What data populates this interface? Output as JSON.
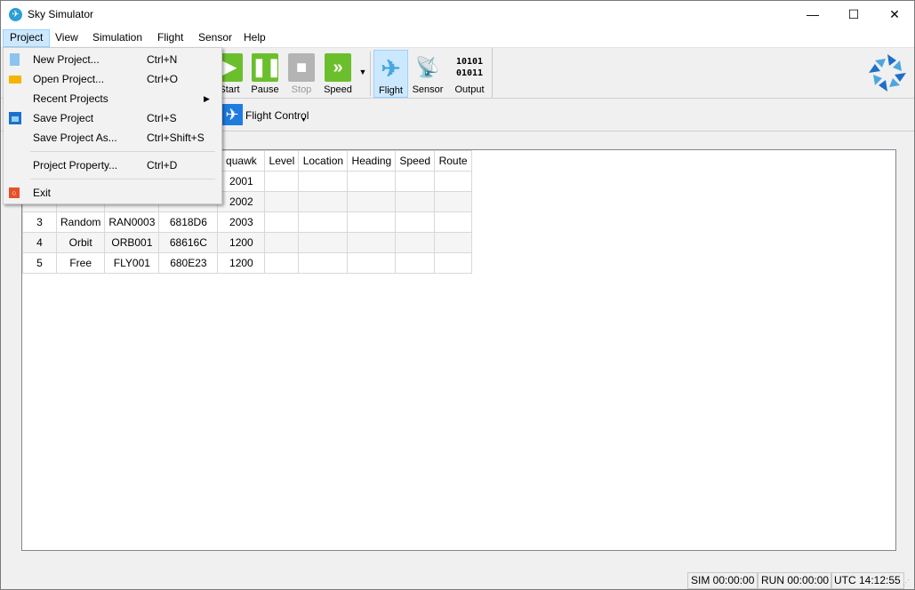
{
  "window": {
    "title": "Sky Simulator",
    "minimize": "—",
    "maximize": "☐",
    "close": "✕"
  },
  "menubar": [
    "Project",
    "View",
    "Simulation",
    "Flight",
    "Sensor",
    "Help"
  ],
  "toolbar": {
    "start": "Start",
    "pause": "Pause",
    "stop": "Stop",
    "speed": "Speed",
    "flight": "Flight",
    "sensor": "Sensor",
    "output": "Output",
    "output_glyph": "10101\n01011"
  },
  "toolbar2": {
    "flight_control": "Flight Control"
  },
  "project_menu": [
    {
      "label": "New Project...",
      "shortcut": "Ctrl+N",
      "icon": "new-file-icon"
    },
    {
      "label": "Open Project...",
      "shortcut": "Ctrl+O",
      "icon": "folder-icon"
    },
    {
      "label": "Recent Projects",
      "shortcut": "",
      "icon": "submenu-arrow-icon"
    },
    {
      "label": "Save Project",
      "shortcut": "Ctrl+S",
      "icon": "save-icon"
    },
    {
      "label": "Save Project As...",
      "shortcut": "Ctrl+Shift+S",
      "icon": ""
    },
    {
      "label": "Project Property...",
      "shortcut": "Ctrl+D",
      "icon": ""
    },
    {
      "label": "Exit",
      "shortcut": "",
      "icon": "power-icon"
    }
  ],
  "table": {
    "headers": [
      "",
      "",
      "",
      "",
      "quawk",
      "Level",
      "Location",
      "Heading",
      "Speed",
      "Route"
    ],
    "rows": [
      [
        "",
        "",
        "",
        "",
        "2001",
        "",
        "",
        "",
        "",
        ""
      ],
      [
        "",
        "",
        "",
        "",
        "2002",
        "",
        "",
        "",
        "",
        ""
      ],
      [
        "3",
        "Random",
        "RAN0003",
        "6818D6",
        "2003",
        "",
        "",
        "",
        "",
        ""
      ],
      [
        "4",
        "Orbit",
        "ORB001",
        "68616C",
        "1200",
        "",
        "",
        "",
        "",
        ""
      ],
      [
        "5",
        "Free",
        "FLY001",
        "680E23",
        "1200",
        "",
        "",
        "",
        "",
        ""
      ]
    ]
  },
  "status": {
    "sim": "SIM 00:00:00",
    "run": "RUN 00:00:00",
    "utc": "UTC 14:12:55"
  },
  "colors": {
    "green": "#6cbf2c",
    "gray": "#b4b4b4",
    "accent": "#cce8ff",
    "blue": "#1e7be0"
  }
}
